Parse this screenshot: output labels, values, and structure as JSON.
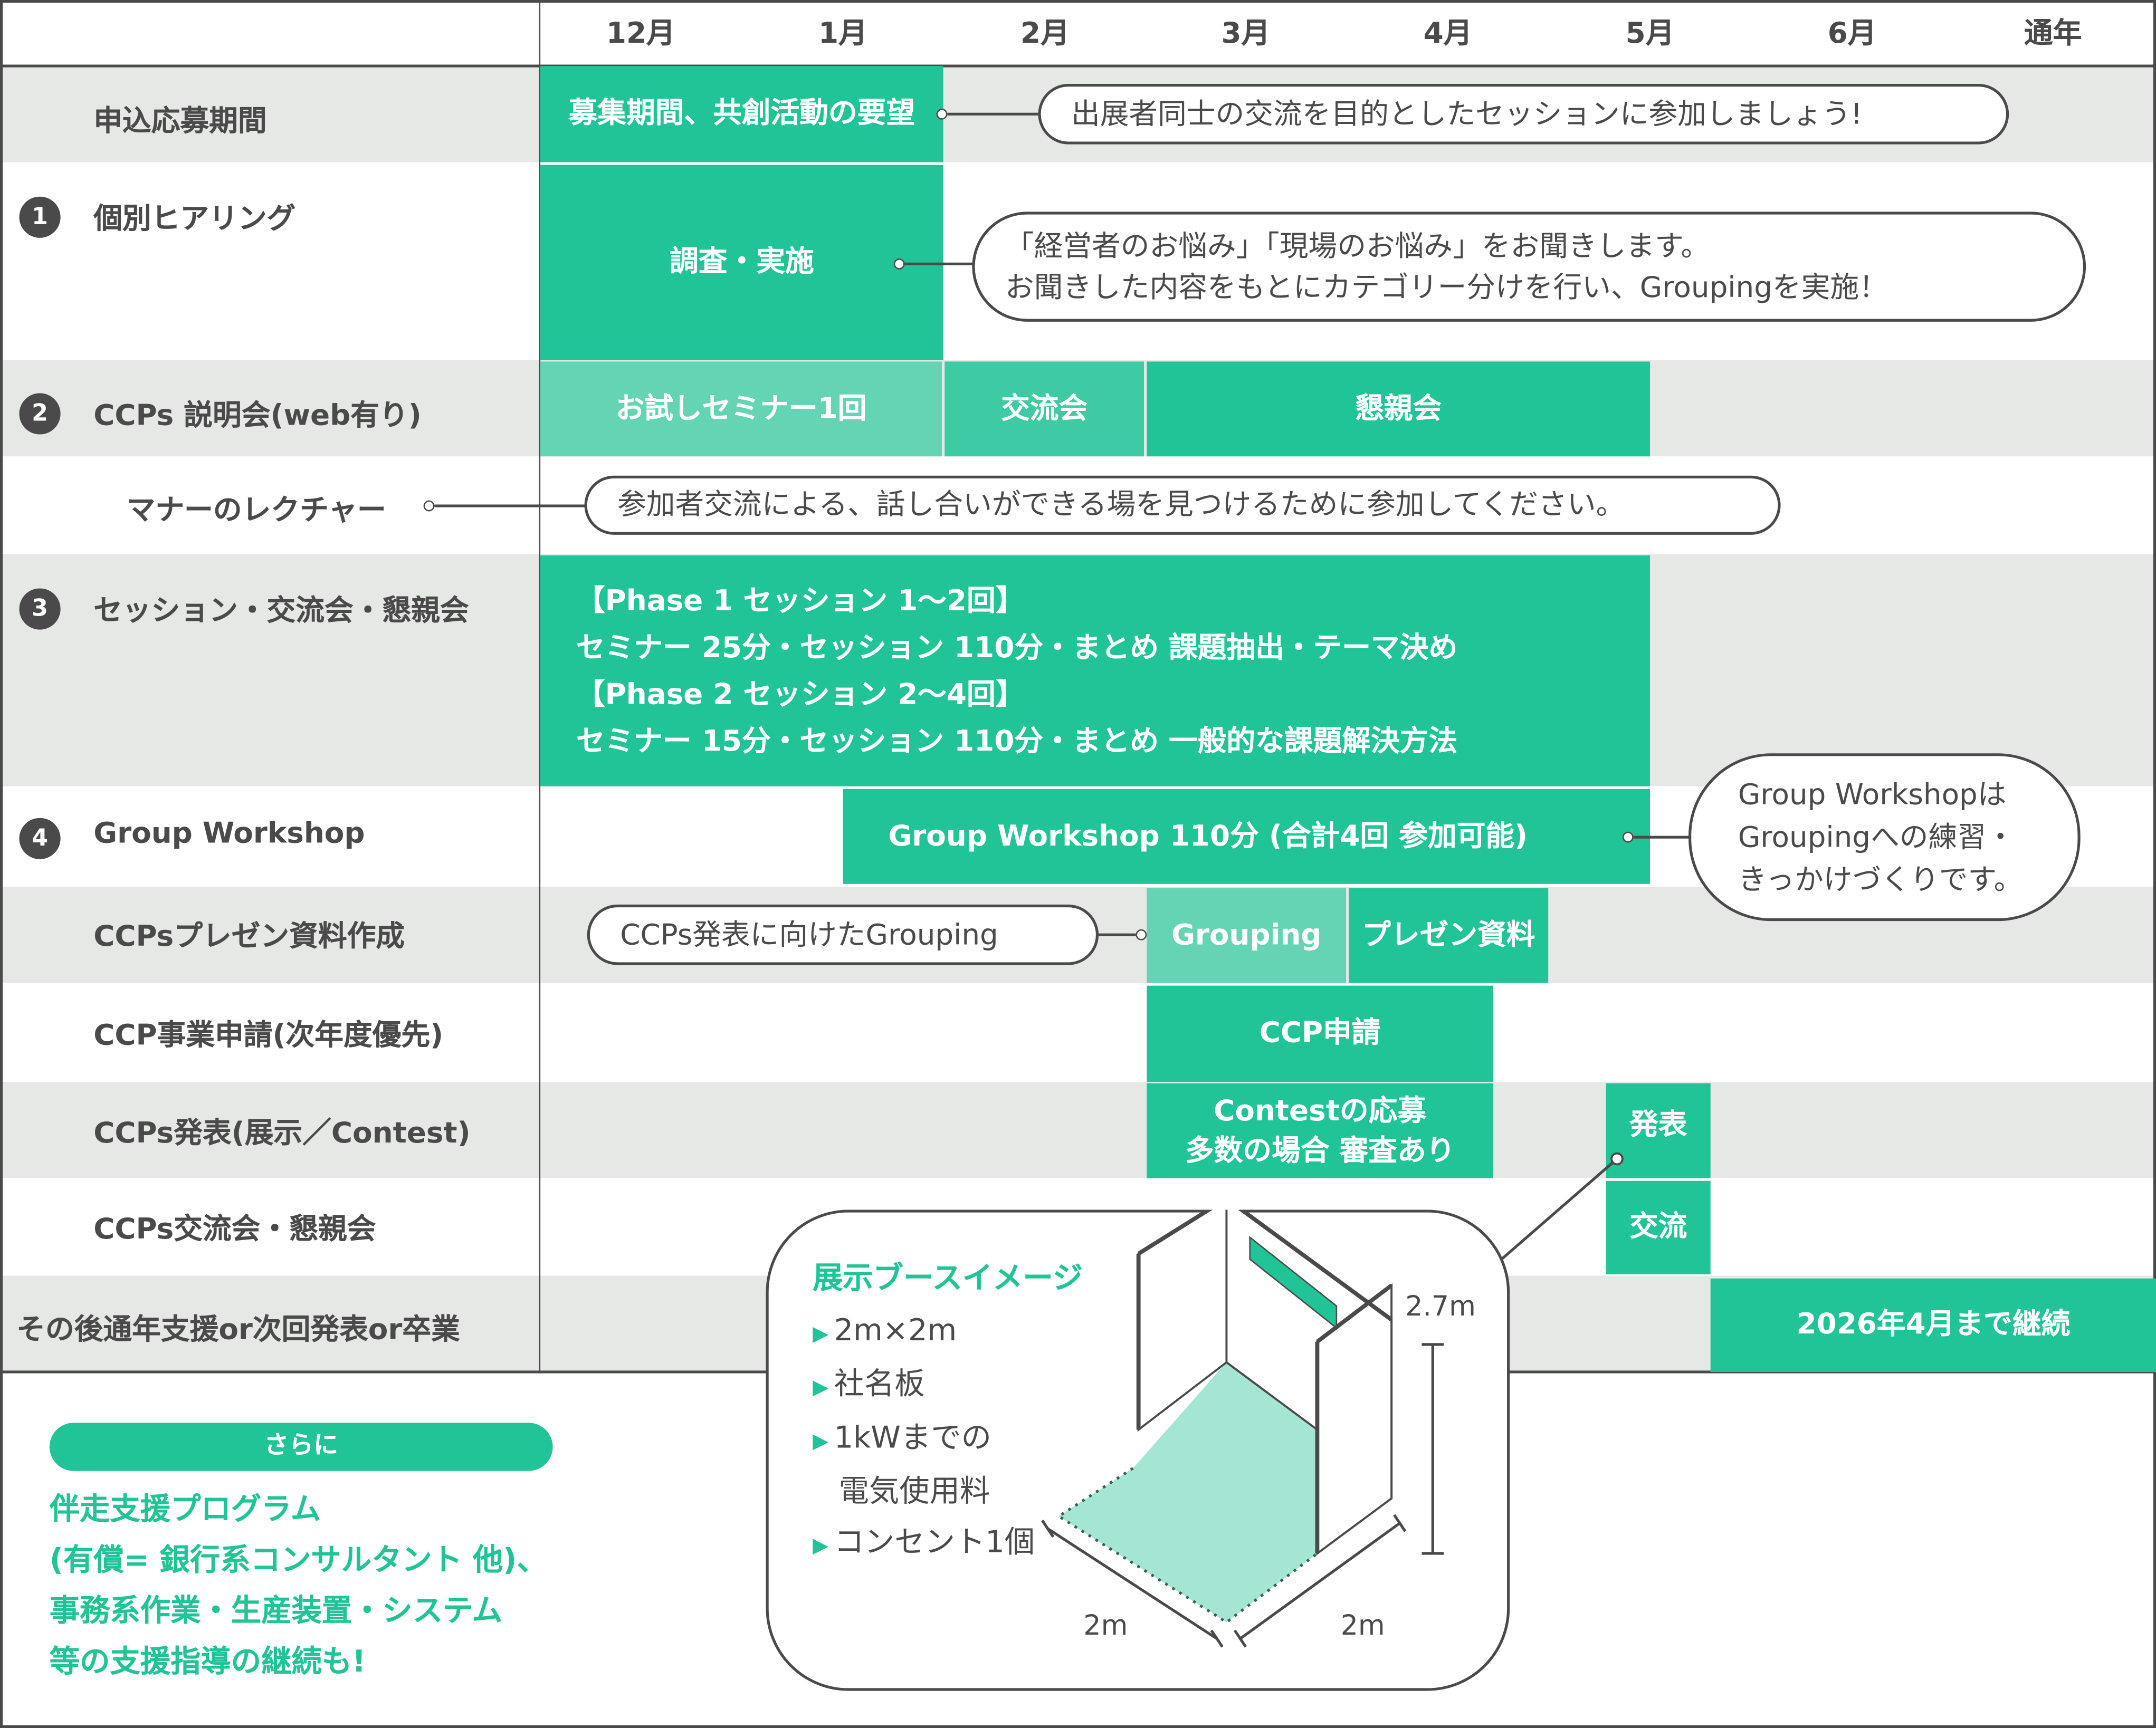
{
  "colors": {
    "accent": "#20c497",
    "accent_light": "#64d4b4",
    "accent_mid": "#3ecaa2",
    "row_gray": "#e6e8e6",
    "text": "#4a4a4a",
    "floor": "#a4e6d3"
  },
  "header": {
    "months": [
      "12月",
      "1月",
      "2月",
      "3月",
      "4月",
      "5月",
      "6月",
      "通年"
    ]
  },
  "rows": [
    {
      "label": "申込応募期間"
    },
    {
      "number": "1",
      "label": "個別ヒアリング"
    },
    {
      "number": "2",
      "label": "CCPs 説明会(web有り)"
    },
    {
      "label": "マナーのレクチャー"
    },
    {
      "number": "3",
      "label": "セッション・交流会・懇親会"
    },
    {
      "number": "4",
      "label": "Group Workshop"
    },
    {
      "label": "CCPsプレゼン資料作成"
    },
    {
      "label": "CCP事業申請(次年度優先)"
    },
    {
      "label": "CCPs発表(展示／Contest)"
    },
    {
      "label": "CCPs交流会・懇親会"
    },
    {
      "label": "その後通年支援or次回発表or卒業"
    }
  ],
  "bars": {
    "recruit": "募集期間、共創活動の要望",
    "hearing": "調査・実施",
    "trial_seminar": "お試しセミナー1回",
    "exchange": "交流会",
    "social": "懇親会",
    "session_lines": [
      "【Phase 1 セッション 1〜2回】",
      "セミナー 25分・セッション 110分・まとめ 課題抽出・テーマ決め",
      "【Phase 2 セッション 2〜4回】",
      "セミナー 15分・セッション 110分・まとめ 一般的な課題解決方法"
    ],
    "workshop": "Group Workshop 110分 (合計4回 参加可能)",
    "grouping": "Grouping",
    "presentation_material": "プレゼン資料",
    "ccp_application": "CCP申請",
    "contest_lines": [
      "Contestの応募",
      "多数の場合 審査あり"
    ],
    "presentation": "発表",
    "networking": "交流",
    "continuation": "2026年4月まで継続"
  },
  "callouts": {
    "recruit": "出展者同士の交流を目的としたセッションに参加しましょう!",
    "hearing_lines": [
      "「経営者のお悩み」「現場のお悩み」をお聞きします。",
      "お聞きした内容をもとにカテゴリー分けを行い、Groupingを実施！"
    ],
    "manners": "参加者交流による、話し合いができる場を見つけるために参加してください。",
    "workshop_lines": [
      "Group Workshopは",
      "Groupingへの練習・",
      "きっかけづくりです。"
    ],
    "grouping": "CCPs発表に向けたGrouping"
  },
  "extra": {
    "badge": "さらに",
    "lines": [
      "伴走支援プログラム",
      "(有償= 銀行系コンサルタント 他)、",
      "事務系作業・生産装置・システム",
      "等の支援指導の継続も!"
    ]
  },
  "booth": {
    "title": "展示ブースイメージ",
    "items": [
      "2m×2m",
      "社名板",
      "1kWまでの",
      "電気使用料",
      "コンセント1個"
    ],
    "item_bullets": [
      true,
      true,
      true,
      false,
      true
    ],
    "dim_height": "2.7m",
    "dim_left": "2m",
    "dim_right": "2m"
  }
}
